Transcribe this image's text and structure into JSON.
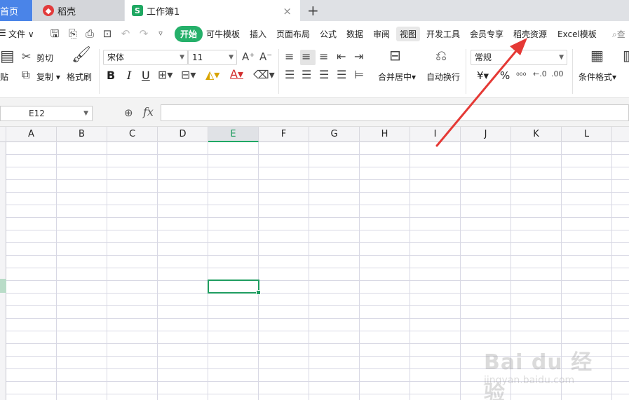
{
  "tabs": {
    "home": "首页",
    "doke": "稻壳",
    "workbook": "工作簿1",
    "add": "+",
    "close": "×"
  },
  "menu": {
    "file": "文件",
    "items": [
      "开始",
      "可牛模板",
      "插入",
      "页面布局",
      "公式",
      "数据",
      "审阅",
      "视图",
      "开发工具",
      "会员专享",
      "稻壳资源",
      "Excel模板"
    ],
    "search_glyph": "查"
  },
  "ribbon": {
    "cut": "剪切",
    "paste": "贴",
    "copy": "复制",
    "format_painter": "格式刷",
    "font_name": "宋体",
    "font_size": "11",
    "bold": "B",
    "italic": "I",
    "underline": "U",
    "merge_center": "合并居中",
    "wrap_text": "自动换行",
    "number_format": "常规",
    "currency": "¥",
    "percent": "%",
    "conditional_format": "条件格式"
  },
  "formula_bar": {
    "cell_ref": "E12",
    "fx": "fx",
    "formula": ""
  },
  "grid": {
    "columns": [
      "A",
      "B",
      "C",
      "D",
      "E",
      "F",
      "G",
      "H",
      "I",
      "J",
      "K",
      "L"
    ],
    "active_column": "E",
    "active_cell": "E12"
  },
  "watermark": {
    "brand": "Bai du 经验",
    "url": "jingyan.baidu.com"
  },
  "colors": {
    "accent_green": "#1f9d60",
    "home_tab_blue": "#4a84e8",
    "annotation_red": "#e53935"
  }
}
